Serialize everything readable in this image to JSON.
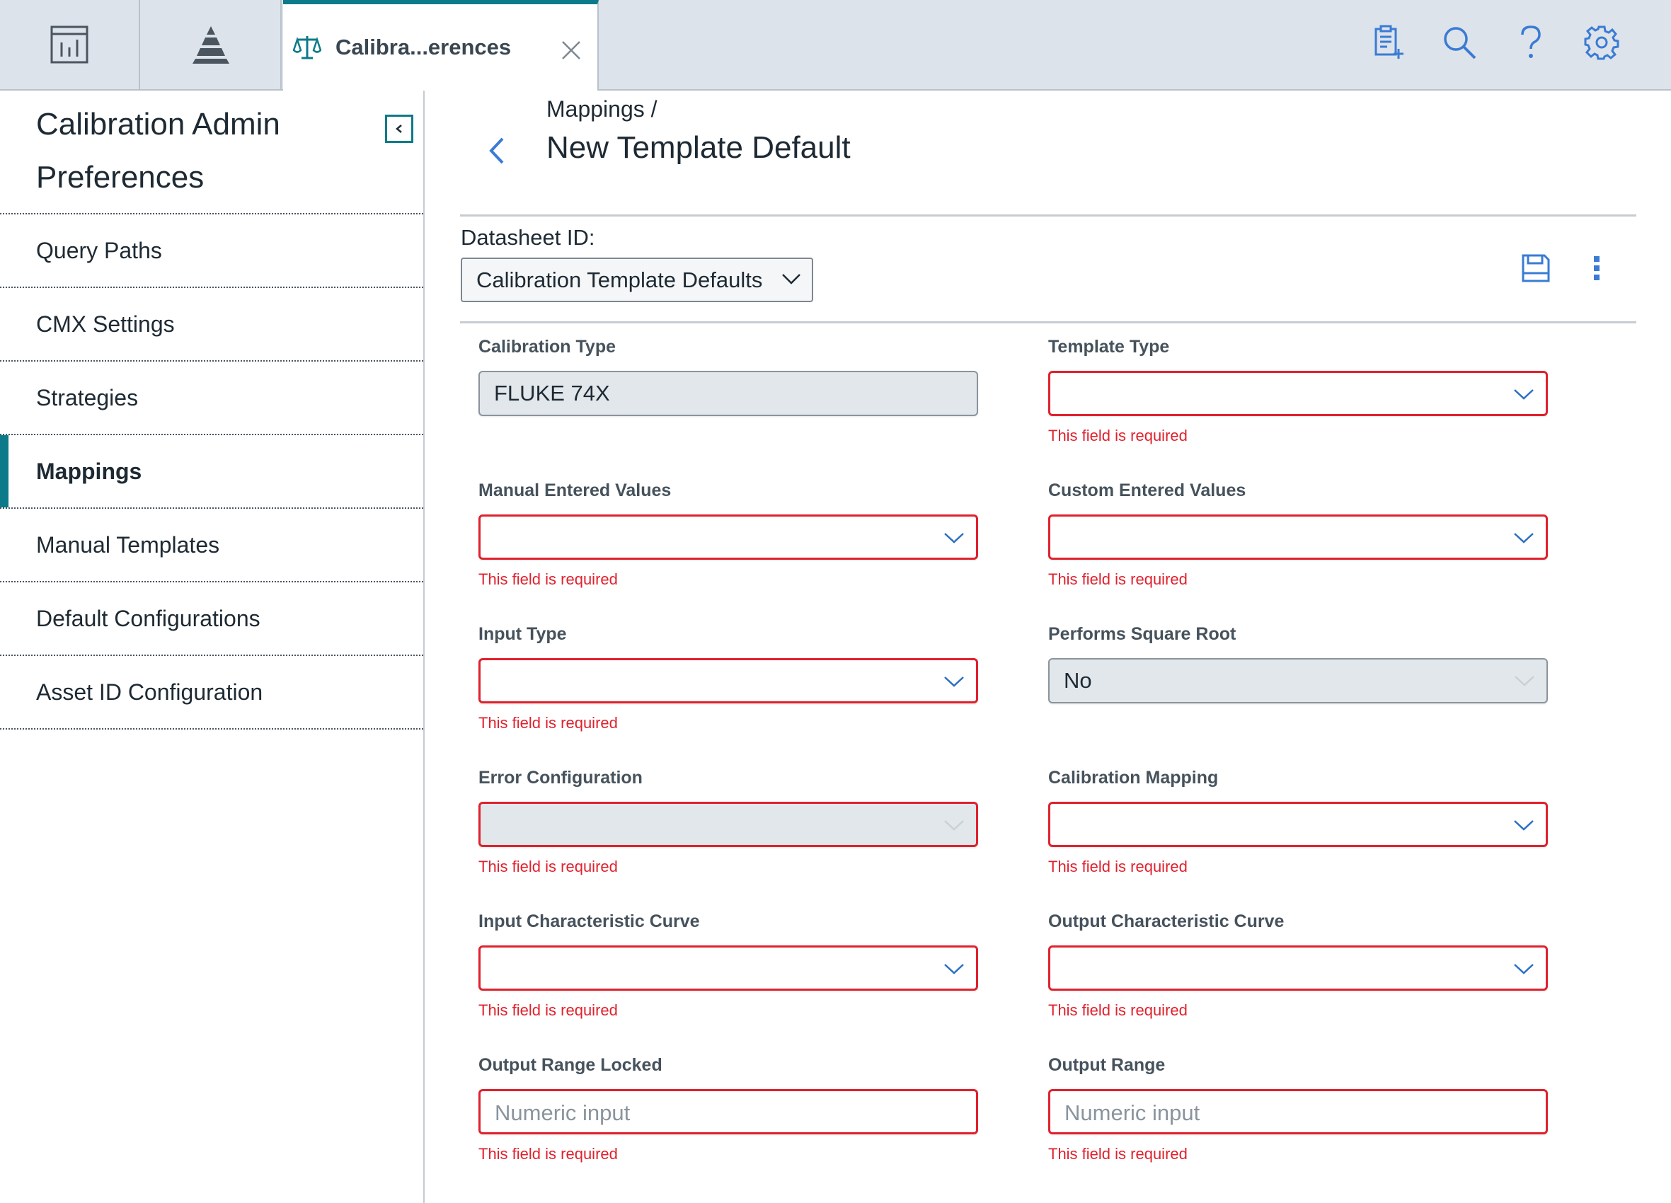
{
  "topbar": {
    "tab1_icon": "dashboard-icon",
    "tab2_icon": "pyramid-icon",
    "active_tab": {
      "label": "Calibra...erences",
      "icon": "balance-scale-icon",
      "close_icon": "close-icon"
    },
    "actions": [
      "notes-add-icon",
      "search-icon",
      "help-icon",
      "gear-icon"
    ]
  },
  "sidebar": {
    "title": "Calibration Admin Preferences",
    "collapse_icon": "chevron-left-icon",
    "items": [
      {
        "label": "Query Paths",
        "active": false
      },
      {
        "label": "CMX Settings",
        "active": false
      },
      {
        "label": "Strategies",
        "active": false
      },
      {
        "label": "Mappings",
        "active": true
      },
      {
        "label": "Manual Templates",
        "active": false
      },
      {
        "label": "Default Configurations",
        "active": false
      },
      {
        "label": "Asset ID Configuration",
        "active": false
      }
    ]
  },
  "main": {
    "breadcrumb": "Mappings /",
    "title": "New Template Default",
    "datasheet_label": "Datasheet ID:",
    "datasheet_value": "Calibration Template Defaults",
    "save_icon": "save-icon",
    "more_icon": "more-vertical-icon"
  },
  "form": {
    "error_text": "This field is required",
    "fields": {
      "calibration_type": {
        "label": "Calibration Type",
        "value": "FLUKE 74X"
      },
      "template_type": {
        "label": "Template Type",
        "value": ""
      },
      "manual_entered_values": {
        "label": "Manual Entered Values",
        "value": ""
      },
      "custom_entered_values": {
        "label": "Custom Entered Values",
        "value": ""
      },
      "input_type": {
        "label": "Input Type",
        "value": ""
      },
      "performs_square_root": {
        "label": "Performs Square Root",
        "value": "No"
      },
      "error_configuration": {
        "label": "Error Configuration",
        "value": ""
      },
      "calibration_mapping": {
        "label": "Calibration Mapping",
        "value": ""
      },
      "input_characteristic_curve": {
        "label": "Input Characteristic Curve",
        "value": ""
      },
      "output_characteristic_curve": {
        "label": "Output Characteristic Curve",
        "value": ""
      },
      "output_range_locked": {
        "label": "Output Range Locked",
        "placeholder": "Numeric input"
      },
      "output_range": {
        "label": "Output Range",
        "placeholder": "Numeric input"
      }
    }
  },
  "colors": {
    "accent": "#0d7a8a",
    "error": "#e0212d",
    "link_blue": "#3a7bd5"
  }
}
